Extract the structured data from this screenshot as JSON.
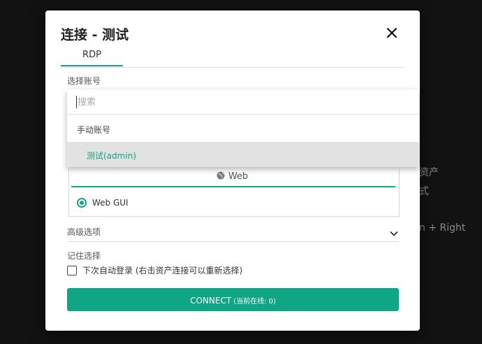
{
  "background": {
    "fragments": [
      "资产",
      "式",
      "n + Right"
    ]
  },
  "dialog": {
    "title": "连接 - 测试",
    "tabs": [
      {
        "label": "RDP"
      }
    ],
    "select_account_label": "选择账号",
    "search": {
      "placeholder": "搜索",
      "value": ""
    },
    "account_group": "手动账号",
    "account_options": [
      {
        "label": "测试(admin)"
      }
    ],
    "protocol_tab": {
      "label": "Web",
      "icon": "globe-icon"
    },
    "connect_methods": [
      {
        "label": "Web GUI",
        "selected": true
      }
    ],
    "advanced_label": "高级选项",
    "remember_label": "记住选择",
    "auto_login_label": "下次自动登录 (右击资产连接可以重新选择)",
    "auto_login_checked": false,
    "connect_button": {
      "main": "CONNECT",
      "sub": "(当前在线: 0)"
    },
    "colors": {
      "accent": "#0fa685",
      "highlight": "#e2e2e2"
    }
  }
}
